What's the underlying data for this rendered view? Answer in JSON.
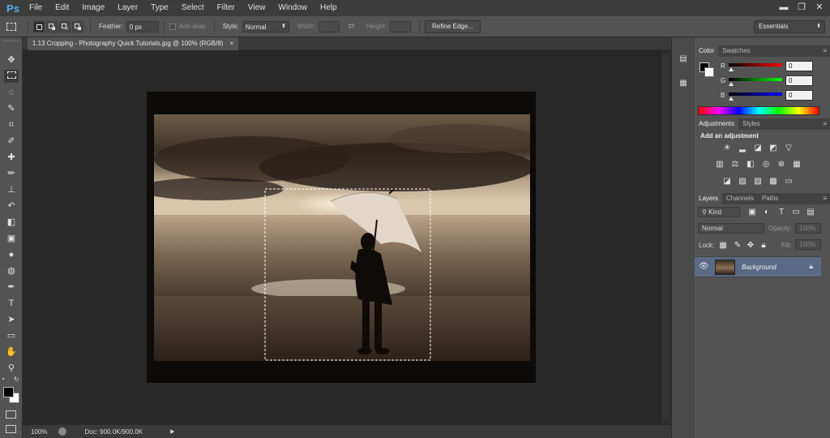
{
  "app": {
    "logo": "Ps"
  },
  "menu": [
    "File",
    "Edit",
    "Image",
    "Layer",
    "Type",
    "Select",
    "Filter",
    "View",
    "Window",
    "Help"
  ],
  "window_controls": {
    "minimize": "▬",
    "restore": "❐",
    "close": "✕"
  },
  "options": {
    "feather_label": "Feather:",
    "feather_value": "0 px",
    "antialias_label": "Anti-alias",
    "style_label": "Style:",
    "style_value": "Normal",
    "width_label": "Width:",
    "height_label": "Height:",
    "refine_edge": "Refine Edge...",
    "workspace": "Essentials"
  },
  "document": {
    "tab_title": "1.13 Cropping - Photography Quick Tutorials.jpg @ 100% (RGB/8)",
    "tab_close": "×",
    "zoom": "100%",
    "doc_info": "Doc: 900.0K/900.0K"
  },
  "color_panel": {
    "tabs": [
      "Color",
      "Swatches"
    ],
    "channels": [
      {
        "label": "R",
        "value": "0",
        "gradient": "linear-gradient(90deg,#000,#ff0000)"
      },
      {
        "label": "G",
        "value": "0",
        "gradient": "linear-gradient(90deg,#000,#00ff00)"
      },
      {
        "label": "B",
        "value": "0",
        "gradient": "linear-gradient(90deg,#000,#0000ff)"
      }
    ]
  },
  "adjustments_panel": {
    "tabs": [
      "Adjustments",
      "Styles"
    ],
    "heading": "Add an adjustment"
  },
  "layers_panel": {
    "tabs": [
      "Layers",
      "Channels",
      "Paths"
    ],
    "kind": "Kind",
    "blend_mode": "Normal",
    "opacity_label": "Opacity:",
    "opacity_value": "100%",
    "lock_label": "Lock:",
    "fill_label": "Fill:",
    "fill_value": "100%",
    "layers": [
      {
        "name": "Background"
      }
    ]
  },
  "colors": {
    "accent": "#4fb0e8",
    "layer_selected": "#5a6a84"
  }
}
